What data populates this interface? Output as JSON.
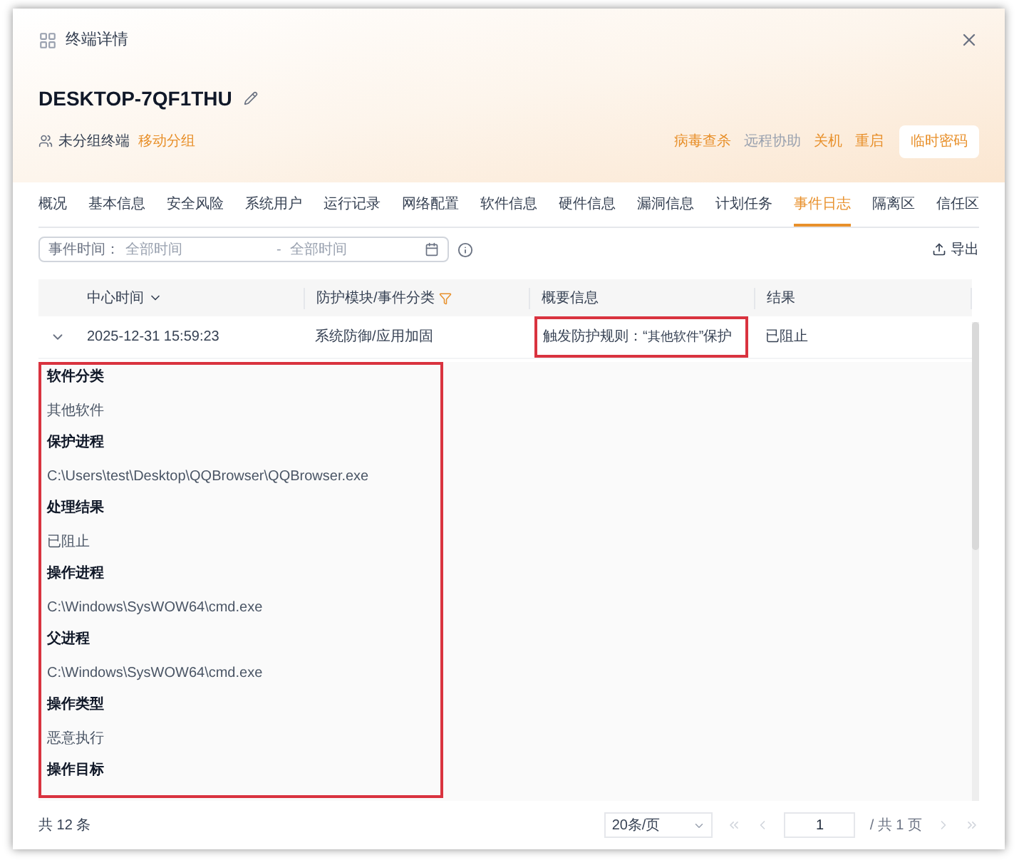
{
  "dialog": {
    "title": "终端详情"
  },
  "host": {
    "name": "DESKTOP-7QF1THU",
    "group": "未分组终端",
    "move_group": "移动分组"
  },
  "actions": [
    {
      "label": "病毒查杀",
      "disabled": false
    },
    {
      "label": "远程协助",
      "disabled": true
    },
    {
      "label": "关机",
      "disabled": false
    },
    {
      "label": "重启",
      "disabled": false
    }
  ],
  "temp_password_button": "临时密码",
  "tabs": [
    {
      "label": "概况",
      "selected": false
    },
    {
      "label": "基本信息",
      "selected": false
    },
    {
      "label": "安全风险",
      "selected": false
    },
    {
      "label": "系统用户",
      "selected": false
    },
    {
      "label": "运行记录",
      "selected": false
    },
    {
      "label": "网络配置",
      "selected": false
    },
    {
      "label": "软件信息",
      "selected": false
    },
    {
      "label": "硬件信息",
      "selected": false
    },
    {
      "label": "漏洞信息",
      "selected": false
    },
    {
      "label": "计划任务",
      "selected": false
    },
    {
      "label": "事件日志",
      "selected": true
    },
    {
      "label": "隔离区",
      "selected": false
    },
    {
      "label": "信任区",
      "selected": false
    }
  ],
  "filter": {
    "label": "事件时间：",
    "start_placeholder": "全部时间",
    "separator": "-",
    "end_placeholder": "全部时间"
  },
  "export_button": "导出",
  "table": {
    "columns": [
      "中心时间",
      "防护模块/事件分类",
      "概要信息",
      "结果"
    ],
    "rows": [
      {
        "expanded": true,
        "time": "2025-12-31 15:59:23",
        "module": "系统防御/应用加固",
        "summary_prefix": "触发防护规则：“",
        "summary_quoted": "其他软件",
        "summary_suffix": "”保护",
        "result": "已阻止",
        "details": [
          {
            "label": "软件分类",
            "value": "其他软件"
          },
          {
            "label": "保护进程",
            "value": "C:\\Users\\test\\Desktop\\QQBrowser\\QQBrowser.exe"
          },
          {
            "label": "处理结果",
            "value": "已阻止"
          },
          {
            "label": "操作进程",
            "value": "C:\\Windows\\SysWOW64\\cmd.exe"
          },
          {
            "label": "父进程",
            "value": "C:\\Windows\\SysWOW64\\cmd.exe"
          },
          {
            "label": "操作类型",
            "value": "恶意执行"
          },
          {
            "label": "操作目标"
          }
        ]
      }
    ]
  },
  "footer": {
    "total": "共 12 条",
    "page_size": "20条/页",
    "page": "1",
    "page_total": "/ 共 1 页"
  }
}
